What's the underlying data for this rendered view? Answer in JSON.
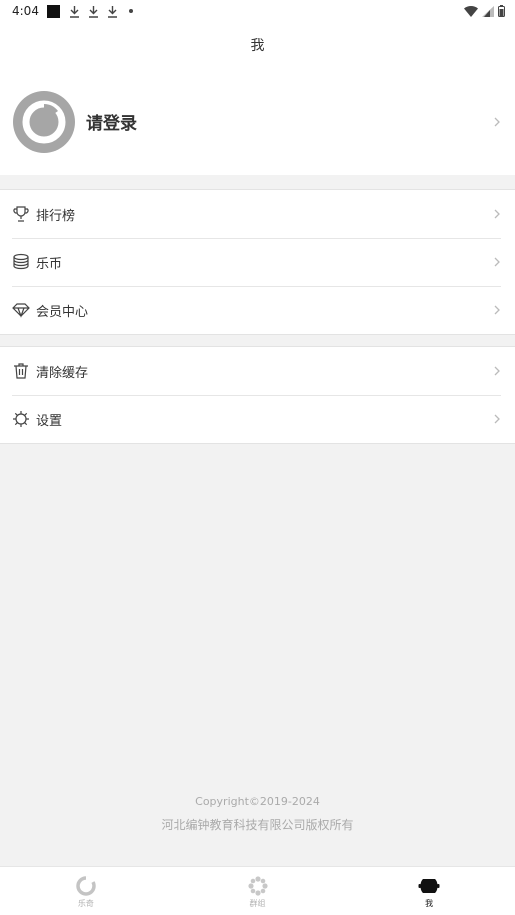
{
  "status_bar": {
    "time": "4:04"
  },
  "header": {
    "title": "我"
  },
  "profile": {
    "login_label": "请登录"
  },
  "menu_group_1": [
    {
      "label": "排行榜",
      "icon": "trophy-icon"
    },
    {
      "label": "乐币",
      "icon": "coins-icon"
    },
    {
      "label": "会员中心",
      "icon": "diamond-icon"
    }
  ],
  "menu_group_2": [
    {
      "label": "清除缓存",
      "icon": "trash-icon"
    },
    {
      "label": "设置",
      "icon": "gear-icon"
    }
  ],
  "footer": {
    "copyright": "Copyright©2019-2024",
    "company": "河北编钟教育科技有限公司版权所有"
  },
  "bottom_nav": [
    {
      "label": "乐奇",
      "icon": "ring-icon",
      "active": false
    },
    {
      "label": "群组",
      "icon": "flower-icon",
      "active": false
    },
    {
      "label": "我",
      "icon": "bell-icon",
      "active": true
    }
  ],
  "colors": {
    "accent": "#222222",
    "inactive": "#b0b0b0",
    "background": "#f2f2f2"
  }
}
